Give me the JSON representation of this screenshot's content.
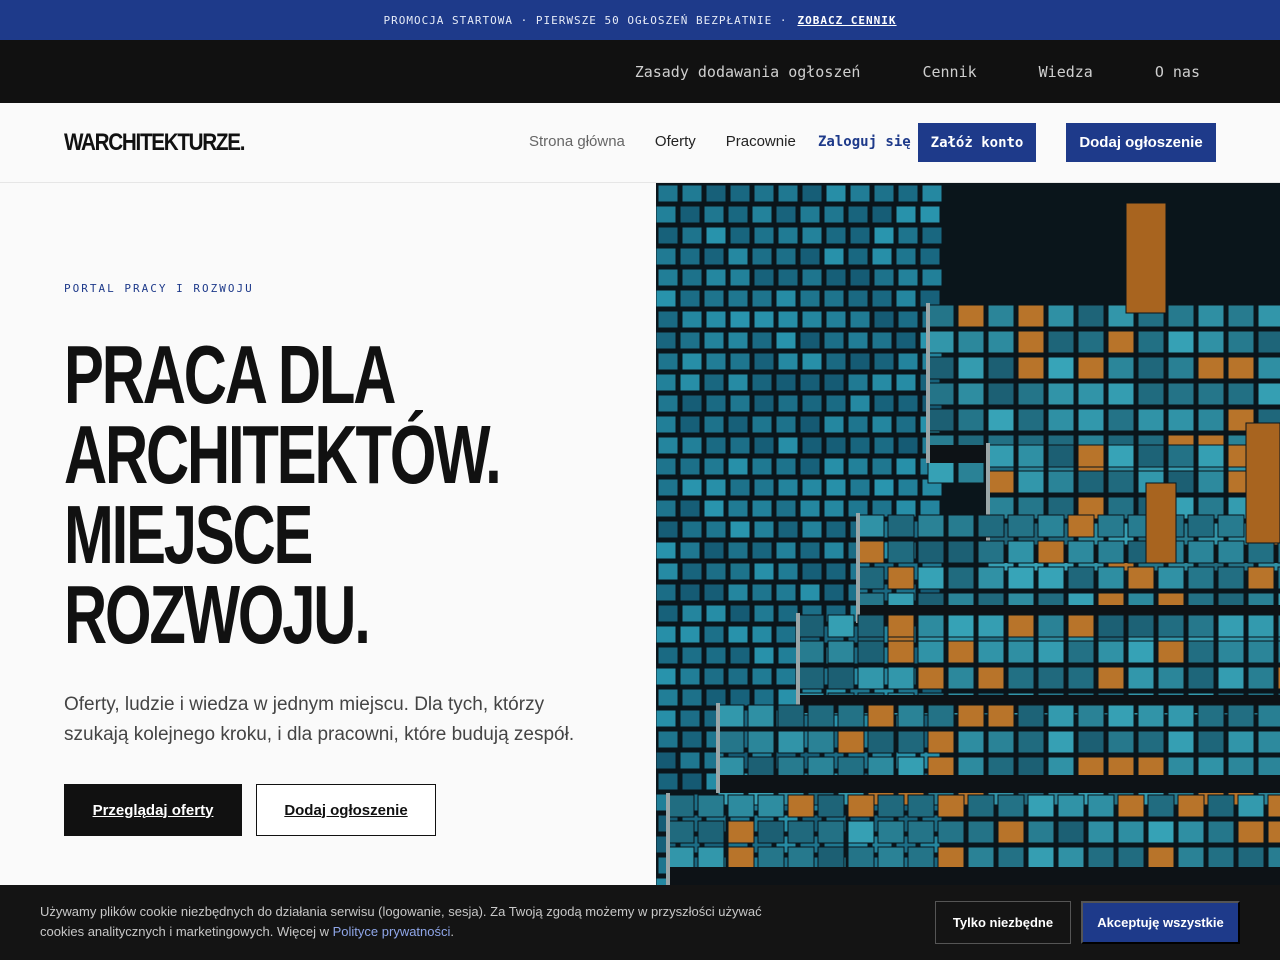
{
  "promo": {
    "text": "PROMOCJA STARTOWA · PIERWSZE 50 OGŁOSZEŃ BEZPŁATNIE ·",
    "link": "ZOBACZ CENNIK"
  },
  "utility_nav": {
    "items": [
      {
        "label": "Zasady dodawania ogłoszeń"
      },
      {
        "label": "Cennik"
      },
      {
        "label": "Wiedza"
      },
      {
        "label": "O nas"
      }
    ]
  },
  "header": {
    "logo": "WARCHITEKTURZE.",
    "links": [
      {
        "label": "Strona główna"
      },
      {
        "label": "Oferty"
      },
      {
        "label": "Pracownie"
      }
    ],
    "login": "Zaloguj się",
    "register": "Załóż konto",
    "add_listing": "Dodaj ogłoszenie"
  },
  "hero": {
    "eyebrow": "PORTAL PRACY I ROZWOJU",
    "headline": [
      "PRACA DLA",
      "ARCHITEKTÓW.",
      "MIEJSCE",
      "ROZWOJU."
    ],
    "lead": "Oferty, ludzie i wiedza w jednym miejscu. Dla tych, którzy szukają kolejnego kroku, i dla pracowni, które budują zespół.",
    "primary_cta": "Przeglądaj oferty",
    "secondary_cta": "Dodaj ogłoszenie"
  },
  "cookie": {
    "text": "Używamy plików cookie niezbędnych do działania serwisu (logowanie, sesja). Za Twoją zgodą możemy w przyszłości używać cookies analitycznych i marketingowych. Więcej w",
    "link": "Polityce prywatności",
    "suffix": ".",
    "necessary": "Tylko niezbędne",
    "accept": "Akceptuję wszystkie"
  },
  "colors": {
    "accent": "#1e3a8a",
    "dark": "#111111",
    "background": "#fafafa"
  }
}
